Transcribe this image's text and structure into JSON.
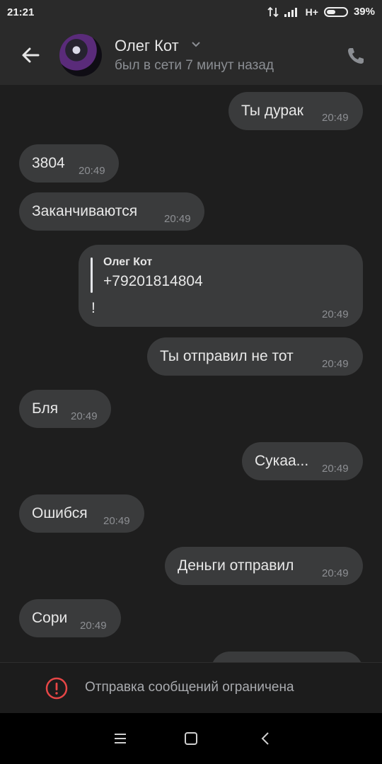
{
  "status_bar": {
    "time": "21:21",
    "network": "H+",
    "battery": "39%"
  },
  "header": {
    "contact_name": "Олег Кот",
    "contact_status": "был в сети 7 минут назад",
    "icons": [
      "back-arrow-icon",
      "avatar",
      "chevron-down-icon",
      "phone-icon"
    ]
  },
  "messages": [
    {
      "dir": "out",
      "text": "Ты дурак",
      "time": "20:49"
    },
    {
      "dir": "in",
      "text": "3804",
      "time": "20:49"
    },
    {
      "dir": "in",
      "text": "Заканчиваются",
      "time": "20:49"
    },
    {
      "dir": "out",
      "reply_author": "Олег Кот",
      "reply_text": "+79201814804",
      "text": "!",
      "time": "20:49"
    },
    {
      "dir": "out",
      "text": "Ты отправил не тот",
      "time": "20:49"
    },
    {
      "dir": "in",
      "text": "Бля",
      "time": "20:49"
    },
    {
      "dir": "out",
      "text": "Сукаа...",
      "time": "20:49"
    },
    {
      "dir": "in",
      "text": "Ошибся",
      "time": "20:49"
    },
    {
      "dir": "out",
      "text": "Деньги отправил",
      "time": "20:49"
    },
    {
      "dir": "in",
      "text": "Сори",
      "time": "20:49"
    }
  ],
  "restriction": {
    "text": "Отправка сообщений ограничена",
    "icon": "alert-circle-icon",
    "color": "#e64646"
  },
  "nav_bar": {
    "icons": [
      "menu-icon",
      "home-square-icon",
      "back-chevron-icon"
    ]
  },
  "colors": {
    "bubble": "#3a3b3c",
    "header": "#2a2a2a",
    "background": "#1e1e1e"
  }
}
